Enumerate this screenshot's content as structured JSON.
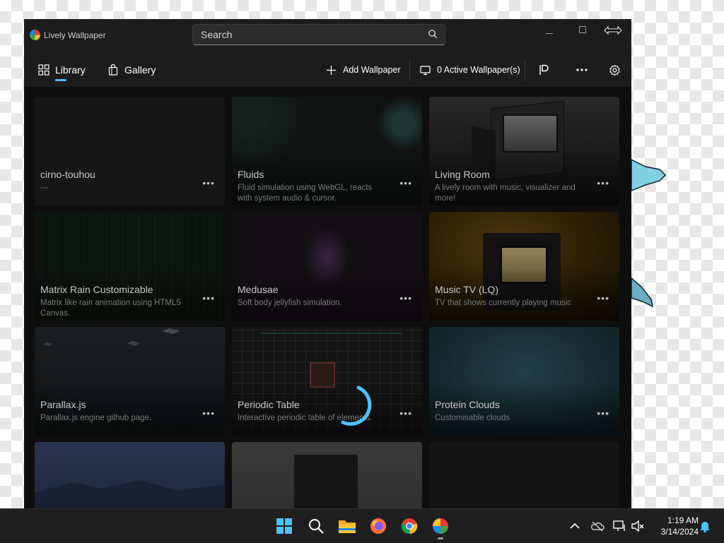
{
  "window": {
    "title": "Lively Wallpaper",
    "search_placeholder": "Search"
  },
  "nav": {
    "tabs": [
      {
        "label": "Library",
        "selected": true
      },
      {
        "label": "Gallery",
        "selected": false
      }
    ],
    "commands": {
      "add_wallpaper": "Add Wallpaper",
      "active_wallpapers": "0 Active Wallpaper(s)"
    }
  },
  "accent_color": "#4cc2ff",
  "wallpapers": [
    {
      "title": "cirno-touhou",
      "description": "---",
      "more": "•••"
    },
    {
      "title": "Fluids",
      "description": "Fluid simulation using WebGL, reacts with system audio & cursor.",
      "more": "•••"
    },
    {
      "title": "Living Room",
      "description": "A lively room with music, visualizer and more!",
      "more": "•••"
    },
    {
      "title": "Matrix Rain Customizable",
      "description": "Matrix like rain animation using HTML5 Canvas.",
      "more": "•••"
    },
    {
      "title": "Medusae",
      "description": "Soft body jellyfish simulation.",
      "more": "•••"
    },
    {
      "title": "Music TV (LQ)",
      "description": "TV that shows currently playing music",
      "more": "•••"
    },
    {
      "title": "Parallax.js",
      "description": "Parallax.js engine github page.",
      "more": "•••"
    },
    {
      "title": "Periodic Table",
      "description": "Interactive periodic table of elements.",
      "more": "•••"
    },
    {
      "title": "Protein Clouds",
      "description": "Customisable clouds",
      "more": "•••"
    }
  ],
  "taskbar": {
    "time": "1:19 AM",
    "date": "3/14/2024",
    "pinned": [
      "start-icon",
      "search-icon",
      "file-explorer-icon",
      "firefox-icon",
      "chrome-icon",
      "lively-wallpaper-icon"
    ]
  }
}
